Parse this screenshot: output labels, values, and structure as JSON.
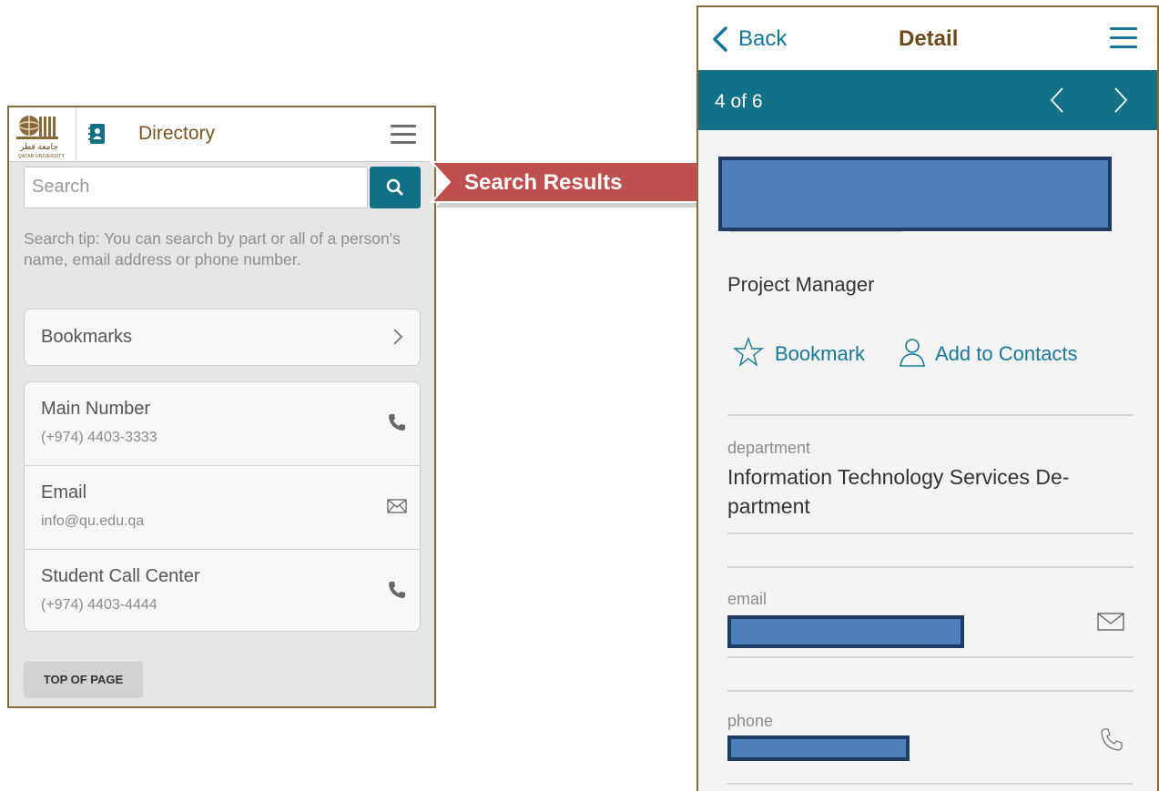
{
  "left_panel": {
    "logo": {
      "arabic_text": "جامعة قطر",
      "english_text": "QATAR UNIVERSITY",
      "icon": "university-logo-icon"
    },
    "section_icon": "address-book-icon",
    "title": "Directory",
    "menu_icon": "hamburger-menu-icon",
    "search": {
      "placeholder": "Search",
      "button_icon": "search-icon"
    },
    "search_tip": "Search tip: You can search by part or all of a person's name, email address or phone number.",
    "bookmarks": {
      "label": "Bookmarks",
      "icon": "chevron-right-icon"
    },
    "contacts": [
      {
        "name": "Main Number",
        "value": "(+974) 4403-3333",
        "icon": "phone-icon"
      },
      {
        "name": "Email",
        "value": "info@qu.edu.qa",
        "icon": "mail-icon"
      },
      {
        "name": "Student Call Center",
        "value": "(+974) 4403-4444",
        "icon": "phone-icon"
      }
    ],
    "top_of_page_label": "TOP OF PAGE"
  },
  "banner": {
    "label": "Search Results",
    "color": "#c0504d"
  },
  "right_panel": {
    "back_label": "Back",
    "title": "Detail",
    "pager": {
      "count_text": "4 of 6",
      "prev_icon": "chevron-left-icon",
      "next_icon": "chevron-right-icon"
    },
    "job_title": "Project Manager",
    "actions": {
      "bookmark_label": "Bookmark",
      "add_contacts_label": "Add to Contacts"
    },
    "fields": {
      "department_label": "department",
      "department_value": "Information Technology Services De-partment",
      "email_label": "email",
      "phone_label": "phone"
    }
  },
  "colors": {
    "teal": "#127087",
    "link_blue": "#15789a",
    "brown": "#7a5320",
    "redaction": "#4e7fbd",
    "redaction_border": "#1f3c63"
  }
}
